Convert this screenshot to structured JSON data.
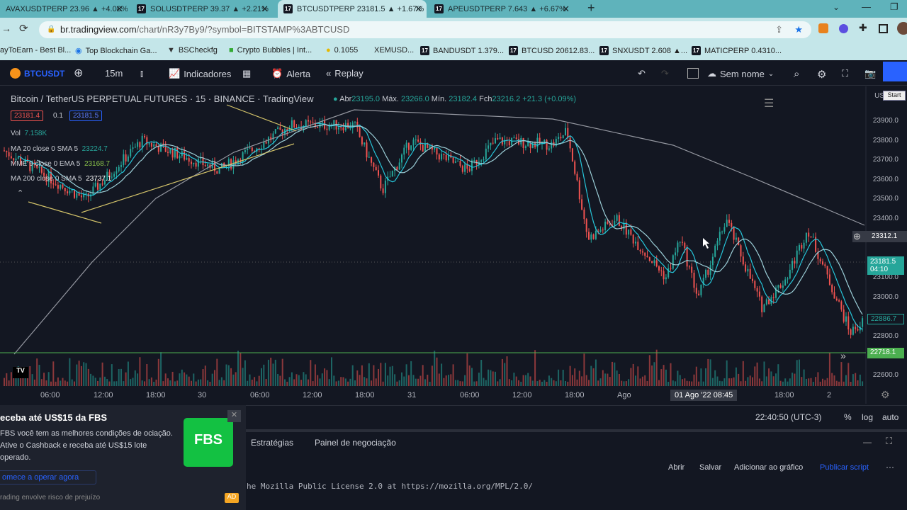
{
  "browser": {
    "tabs": [
      {
        "label": "AVAXUSDTPERP 23.96 ▲ +4.08%"
      },
      {
        "label": "SOLUSDTPERP 39.37 ▲ +2.21%"
      },
      {
        "label": "BTCUSDTPERP 23181.5 ▲ +1.67%"
      },
      {
        "label": "APEUSDTPERP 7.643 ▲ +6.67%"
      }
    ],
    "url_host": "br.tradingview.com",
    "url_path": "/chart/nR3y7By9/?symbol=BITSTAMP%3ABTCUSD",
    "bookmarks": [
      "ayToEarn - Best Bl...",
      "Top Blockchain Ga...",
      "BSCheckfg",
      "Crypto Bubbles | Int...",
      "0.1055",
      "XEMUSD...",
      "BANDUSDT 1.379...",
      "BTCUSD 20612.83...",
      "SNXUSDT 2.608 ▲...",
      "MATICPERP 0.4310..."
    ]
  },
  "toolbar": {
    "symbol": "BTCUSDT",
    "interval": "15m",
    "indicators": "Indicadores",
    "alert": "Alerta",
    "replay": "Replay",
    "layout_name": "Sem nome"
  },
  "legend": {
    "title": "Bitcoin / TetherUS PERPETUAL FUTURES · 15 · BINANCE · TradingView",
    "open_label": "Abr",
    "open": "23195.0",
    "high_label": "Máx.",
    "high": "23266.0",
    "low_label": "Mín.",
    "low": "23182.4",
    "close_label": "Fch",
    "close": "23216.2",
    "change": "+21.3 (+0.09%)",
    "sell": "23181.4",
    "spread": "0.1",
    "buy": "23181.5",
    "vol_label": "Vol",
    "vol": "7.158K",
    "ma20_label": "MA 20 close 0 SMA 5",
    "ma20": "23224.7",
    "mme9_label": "MME 9 close 0 EMA 5",
    "mme9": "23168.7",
    "ma200_label": "MA 200 close 0 SMA 5",
    "ma200": "23737.1"
  },
  "price_axis": {
    "currency": "US",
    "start": "Start",
    "ticks": [
      23900,
      23800,
      23700,
      23600,
      23500,
      23400,
      23100,
      23000,
      22800,
      22600
    ],
    "crosshair": "23312.1",
    "last_price": "23181.5",
    "countdown": "04:10",
    "ma_value": "22886.7",
    "line_value": "22718.1"
  },
  "time_axis": {
    "labels": [
      [
        "06:00",
        71
      ],
      [
        "12:00",
        146
      ],
      [
        "18:00",
        220
      ],
      [
        "30",
        293
      ],
      [
        "06:00",
        367
      ],
      [
        "12:00",
        441
      ],
      [
        "18:00",
        515
      ],
      [
        "31",
        589
      ],
      [
        "06:00",
        663
      ],
      [
        "12:00",
        737
      ],
      [
        "18:00",
        811
      ],
      [
        "Ago",
        885
      ],
      [
        "18:00",
        1107
      ],
      [
        "2",
        1181
      ]
    ],
    "cursor_label": "01 Ago '22   08:45"
  },
  "status": {
    "clock": "22:40:50 (UTC-3)",
    "percent": "%",
    "log": "log",
    "auto": "auto"
  },
  "panel": {
    "tabs": [
      "Estratégias",
      "Painel de negociação"
    ],
    "actions": [
      "Abrir",
      "Salvar",
      "Adicionar ao gráfico",
      "Publicar script"
    ],
    "code_line": "he Mozilla Public License 2.0 at https://mozilla.org/MPL/2.0/"
  },
  "ad": {
    "title": "eceba até US$15 da FBS",
    "body": "FBS você tem as melhores condições de ociação. Ative o Cashback e receba até US$15 lote operado.",
    "cta": "omece a operar agora",
    "disclaimer": "rading envolve risco de prejuízo",
    "logo": "FBS",
    "badge": "AD"
  },
  "colors": {
    "up": "#26a69a",
    "down": "#ef5350",
    "accent": "#2962ff"
  }
}
